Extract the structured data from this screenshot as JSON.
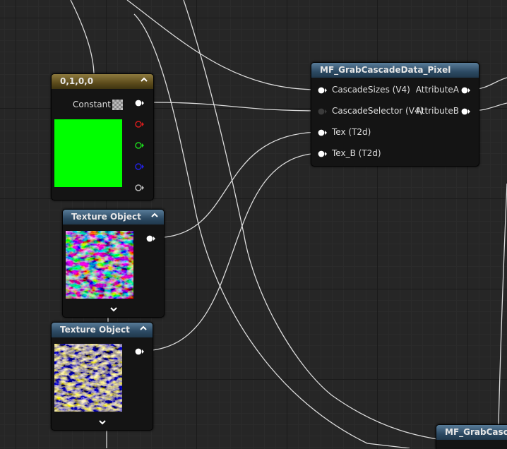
{
  "nodes": {
    "constant": {
      "title": "0,1,0,0",
      "output_label": "Constant",
      "swatch_color": "#00ff00",
      "channel_pins": [
        "red",
        "green",
        "blue",
        "alpha"
      ]
    },
    "texture_object_1": {
      "title": "Texture Object"
    },
    "texture_object_2": {
      "title": "Texture Object"
    },
    "grab_cascade": {
      "title": "MF_GrabCascadeData_Pixel",
      "inputs": [
        "CascadeSizes (V4)",
        "CascadeSelector (V4)",
        "Tex (T2d)",
        "Tex_B (T2d)"
      ],
      "outputs": [
        "AttributeA",
        "AttributeB"
      ]
    },
    "grab_cascade_partial": {
      "title": "MF_GrabCascadeData_Pixel"
    }
  },
  "colors": {
    "background": "#262626",
    "wire": "#e9e9e9",
    "header_blue": "#2c4a63",
    "header_gold": "#5d4c1c",
    "pin_red": "#d41c1c",
    "pin_green": "#1cd41c",
    "pin_blue": "#2222e0",
    "pin_white": "#ffffff"
  },
  "icons": {
    "collapse": "chevron-up-icon",
    "expand": "chevron-down-icon",
    "pin": "pin-arrow-icon"
  }
}
